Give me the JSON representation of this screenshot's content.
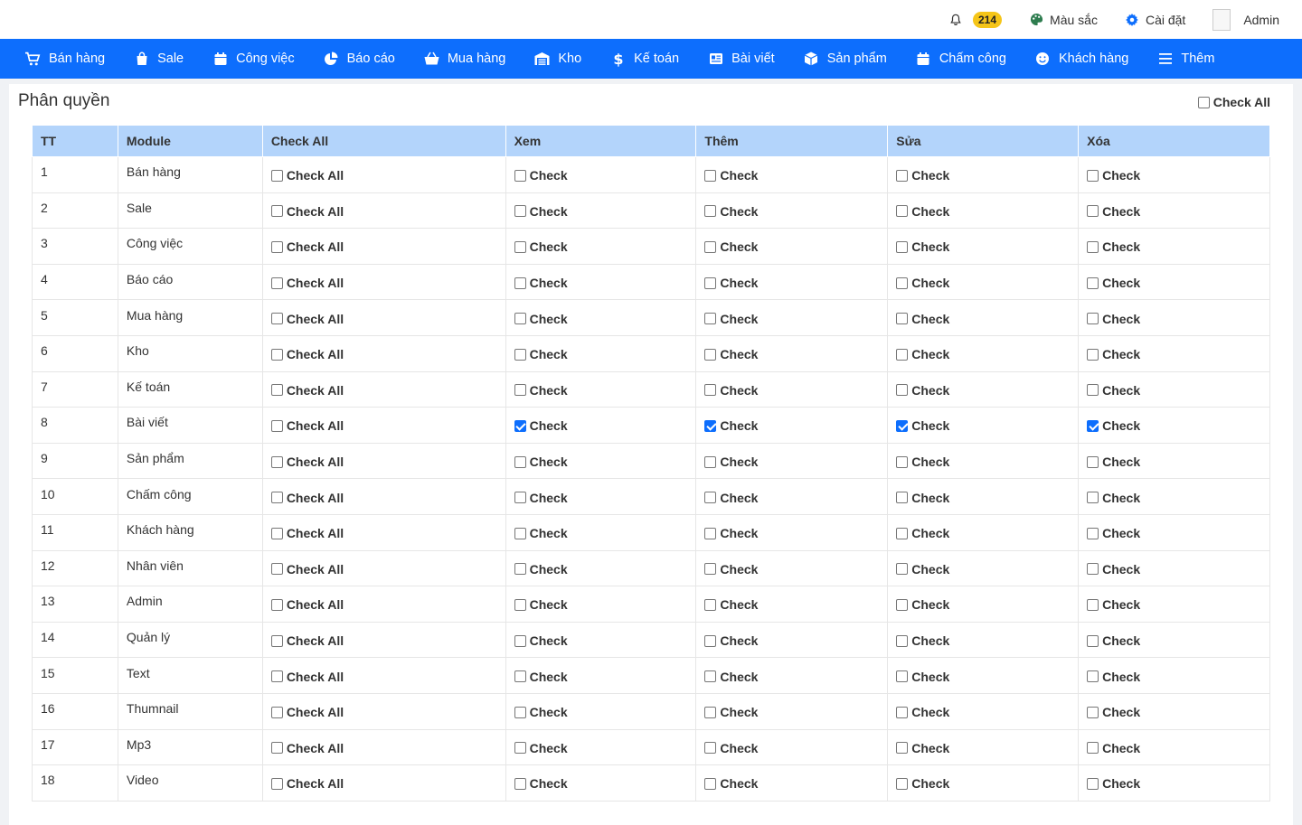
{
  "topbar": {
    "notification_count": "214",
    "color_label": "Màu sắc",
    "settings_label": "Cài đặt",
    "user_label": "Admin"
  },
  "nav": [
    {
      "label": "Bán hàng",
      "icon": "cart-icon"
    },
    {
      "label": "Sale",
      "icon": "bag-icon"
    },
    {
      "label": "Công việc",
      "icon": "calendar-icon"
    },
    {
      "label": "Báo cáo",
      "icon": "pie-chart-icon"
    },
    {
      "label": "Mua hàng",
      "icon": "basket-icon"
    },
    {
      "label": "Kho",
      "icon": "warehouse-icon"
    },
    {
      "label": "Kế toán",
      "icon": "dollar-icon"
    },
    {
      "label": "Bài viết",
      "icon": "article-icon"
    },
    {
      "label": "Sản phẩm",
      "icon": "box-icon"
    },
    {
      "label": "Chấm công",
      "icon": "calendar-icon"
    },
    {
      "label": "Khách hàng",
      "icon": "smile-icon"
    },
    {
      "label": "Thêm",
      "icon": "menu-icon"
    }
  ],
  "page": {
    "title": "Phân quyền",
    "check_all_label": "Check All"
  },
  "table": {
    "headers": [
      "TT",
      "Module",
      "Check All",
      "Xem",
      "Thêm",
      "Sửa",
      "Xóa"
    ],
    "row_check_all_label": "Check All",
    "cell_check_label": "Check",
    "rows": [
      {
        "tt": "1",
        "module": "Bán hàng",
        "checked": [
          false,
          false,
          false,
          false
        ]
      },
      {
        "tt": "2",
        "module": "Sale",
        "checked": [
          false,
          false,
          false,
          false
        ]
      },
      {
        "tt": "3",
        "module": "Công việc",
        "checked": [
          false,
          false,
          false,
          false
        ]
      },
      {
        "tt": "4",
        "module": "Báo cáo",
        "checked": [
          false,
          false,
          false,
          false
        ]
      },
      {
        "tt": "5",
        "module": "Mua hàng",
        "checked": [
          false,
          false,
          false,
          false
        ]
      },
      {
        "tt": "6",
        "module": "Kho",
        "checked": [
          false,
          false,
          false,
          false
        ]
      },
      {
        "tt": "7",
        "module": "Kế toán",
        "checked": [
          false,
          false,
          false,
          false
        ]
      },
      {
        "tt": "8",
        "module": "Bài viết",
        "checked": [
          true,
          true,
          true,
          true
        ]
      },
      {
        "tt": "9",
        "module": "Sản phẩm",
        "checked": [
          false,
          false,
          false,
          false
        ]
      },
      {
        "tt": "10",
        "module": "Chấm công",
        "checked": [
          false,
          false,
          false,
          false
        ]
      },
      {
        "tt": "11",
        "module": "Khách hàng",
        "checked": [
          false,
          false,
          false,
          false
        ]
      },
      {
        "tt": "12",
        "module": "Nhân viên",
        "checked": [
          false,
          false,
          false,
          false
        ]
      },
      {
        "tt": "13",
        "module": "Admin",
        "checked": [
          false,
          false,
          false,
          false
        ]
      },
      {
        "tt": "14",
        "module": "Quản lý",
        "checked": [
          false,
          false,
          false,
          false
        ]
      },
      {
        "tt": "15",
        "module": "Text",
        "checked": [
          false,
          false,
          false,
          false
        ]
      },
      {
        "tt": "16",
        "module": "Thumnail",
        "checked": [
          false,
          false,
          false,
          false
        ]
      },
      {
        "tt": "17",
        "module": "Mp3",
        "checked": [
          false,
          false,
          false,
          false
        ]
      },
      {
        "tt": "18",
        "module": "Video",
        "checked": [
          false,
          false,
          false,
          false
        ]
      }
    ]
  }
}
